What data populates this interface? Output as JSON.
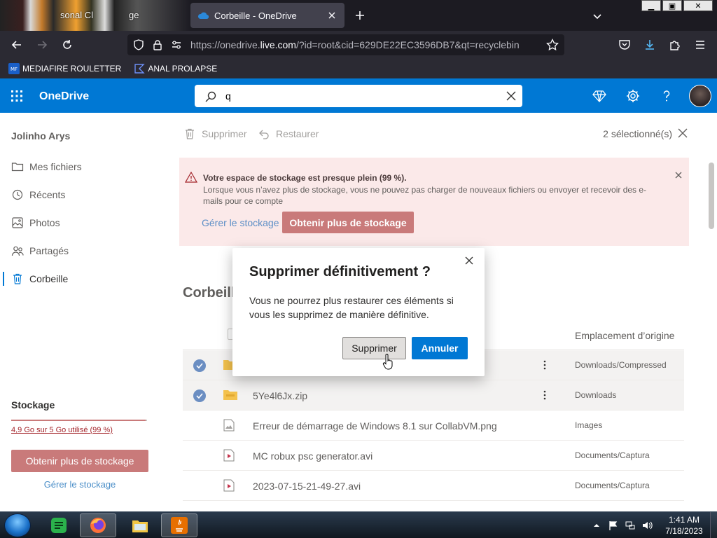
{
  "browser": {
    "bg_tab_fragments": [
      "sonal Cl",
      "ge"
    ],
    "active_tab_title": "Corbeille - OneDrive",
    "url_prefix": "https://onedrive.",
    "url_domain": "live.com",
    "url_suffix": "/?id=root&cid=629DE22EC3596DB7&qt=recyclebin",
    "window_controls": [
      "▁",
      "▣",
      "✕"
    ],
    "bookmarks": [
      {
        "label": "MEDIAFIRE ROULETTER",
        "icon": "mediafire-icon"
      },
      {
        "label": "ANAL PROLAPSE",
        "icon": "bookmark-folder-icon"
      }
    ]
  },
  "header": {
    "brand": "OneDrive",
    "search_value": "q"
  },
  "leftnav": {
    "user": "Jolinho Arys",
    "items": [
      {
        "label": "Mes fichiers",
        "icon": "folder-icon"
      },
      {
        "label": "Récents",
        "icon": "history-icon"
      },
      {
        "label": "Photos",
        "icon": "photo-icon"
      },
      {
        "label": "Partagés",
        "icon": "people-icon"
      },
      {
        "label": "Corbeille",
        "icon": "trash-icon",
        "active": true
      }
    ],
    "storage": {
      "title": "Stockage",
      "used_text": "4,9 Go sur 5 Go utilisé (99 %)",
      "used_fraction": 0.99,
      "get_more": "Obtenir plus de stockage",
      "manage": "Gérer le stockage"
    }
  },
  "commandbar": {
    "delete": "Supprimer",
    "restore": "Restaurer",
    "selected": "2 sélectionné(s)"
  },
  "banner": {
    "title": "Votre espace de stockage est presque plein (99 %).",
    "text": "Lorsque vous n’avez plus de stockage, vous ne pouvez pas charger de nouveaux fichiers ou envoyer et recevoir des e-mails pour ce compte",
    "manage": "Gérer le stockage",
    "get_more": "Obtenir plus de stockage"
  },
  "section_title": "Corbeill",
  "list": {
    "col_location": "Emplacement d’origine",
    "rows": [
      {
        "name": "",
        "location": "Downloads/Compressed",
        "selected": true,
        "type": "folder"
      },
      {
        "name": "5Ye4l6Jx.zip",
        "location": "Downloads",
        "selected": true,
        "type": "zip"
      },
      {
        "name": "Erreur de démarrage de Windows 8.1 sur CollabVM.png",
        "location": "Images",
        "selected": false,
        "type": "image"
      },
      {
        "name": "MC robux psc generator.avi",
        "location": "Documents/Captura",
        "selected": false,
        "type": "video"
      },
      {
        "name": "2023-07-15-21-49-27.avi",
        "location": "Documents/Captura",
        "selected": false,
        "type": "video"
      }
    ]
  },
  "dialog": {
    "title": "Supprimer définitivement ?",
    "text": "Vous ne pourrez plus restaurer ces éléments si vous les supprimez de manière définitive.",
    "confirm": "Supprimer",
    "cancel": "Annuler"
  },
  "taskbar": {
    "time": "1:41 AM",
    "date": "7/18/2023"
  },
  "colors": {
    "accent": "#0078d4",
    "warning_bg": "#fbe9e9",
    "disabled_action": "#c97a7a"
  }
}
